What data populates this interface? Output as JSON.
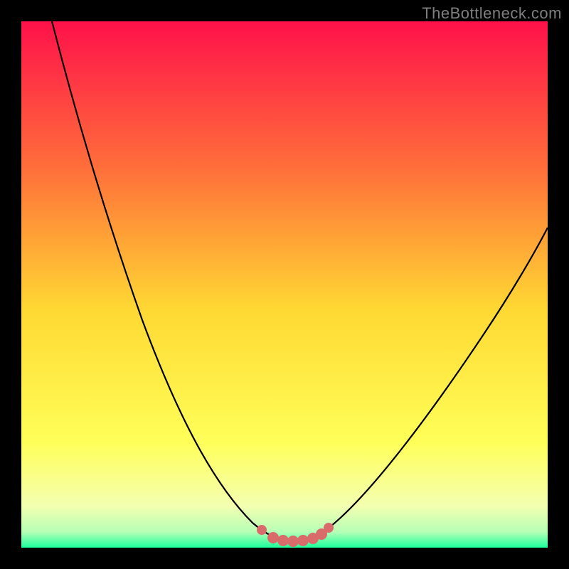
{
  "watermark": "TheBottleneck.com",
  "colors": {
    "background_black": "#000000",
    "gradient_top": "#ff114a",
    "gradient_mid_top": "#ff6f3a",
    "gradient_mid": "#ffd933",
    "gradient_mid_low": "#ffff59",
    "gradient_low": "#f4ffb0",
    "gradient_green": "#1aff9c",
    "curve_stroke": "#000000",
    "blob_fill": "#d96b6b",
    "watermark_color": "#7f7f7f"
  },
  "chart_data": {
    "type": "line",
    "title": "",
    "xlabel": "",
    "ylabel": "",
    "xlim": [
      0,
      100
    ],
    "ylim": [
      0,
      100
    ],
    "series": [
      {
        "name": "bottleneck-curve",
        "x": [
          6,
          10,
          15,
          20,
          25,
          30,
          35,
          40,
          45,
          48,
          50,
          52,
          55,
          58,
          60,
          65,
          70,
          75,
          80,
          85,
          90,
          95,
          100
        ],
        "y": [
          100,
          88,
          73,
          59,
          46,
          35,
          25,
          16,
          8,
          4,
          2,
          1,
          1,
          2,
          4,
          9,
          15,
          22,
          29,
          36,
          44,
          52,
          60
        ]
      }
    ],
    "annotations": [
      {
        "name": "optimal-range-blob",
        "type": "shape",
        "x_start": 48,
        "x_end": 59,
        "y": 1
      }
    ],
    "gradient_stops_percent_to_color": [
      {
        "pct": 0,
        "color": "#ff114a"
      },
      {
        "pct": 30,
        "color": "#ff7a2e"
      },
      {
        "pct": 55,
        "color": "#ffd933"
      },
      {
        "pct": 80,
        "color": "#ffff59"
      },
      {
        "pct": 92,
        "color": "#f4ffb0"
      },
      {
        "pct": 100,
        "color": "#1aff9c"
      }
    ]
  }
}
